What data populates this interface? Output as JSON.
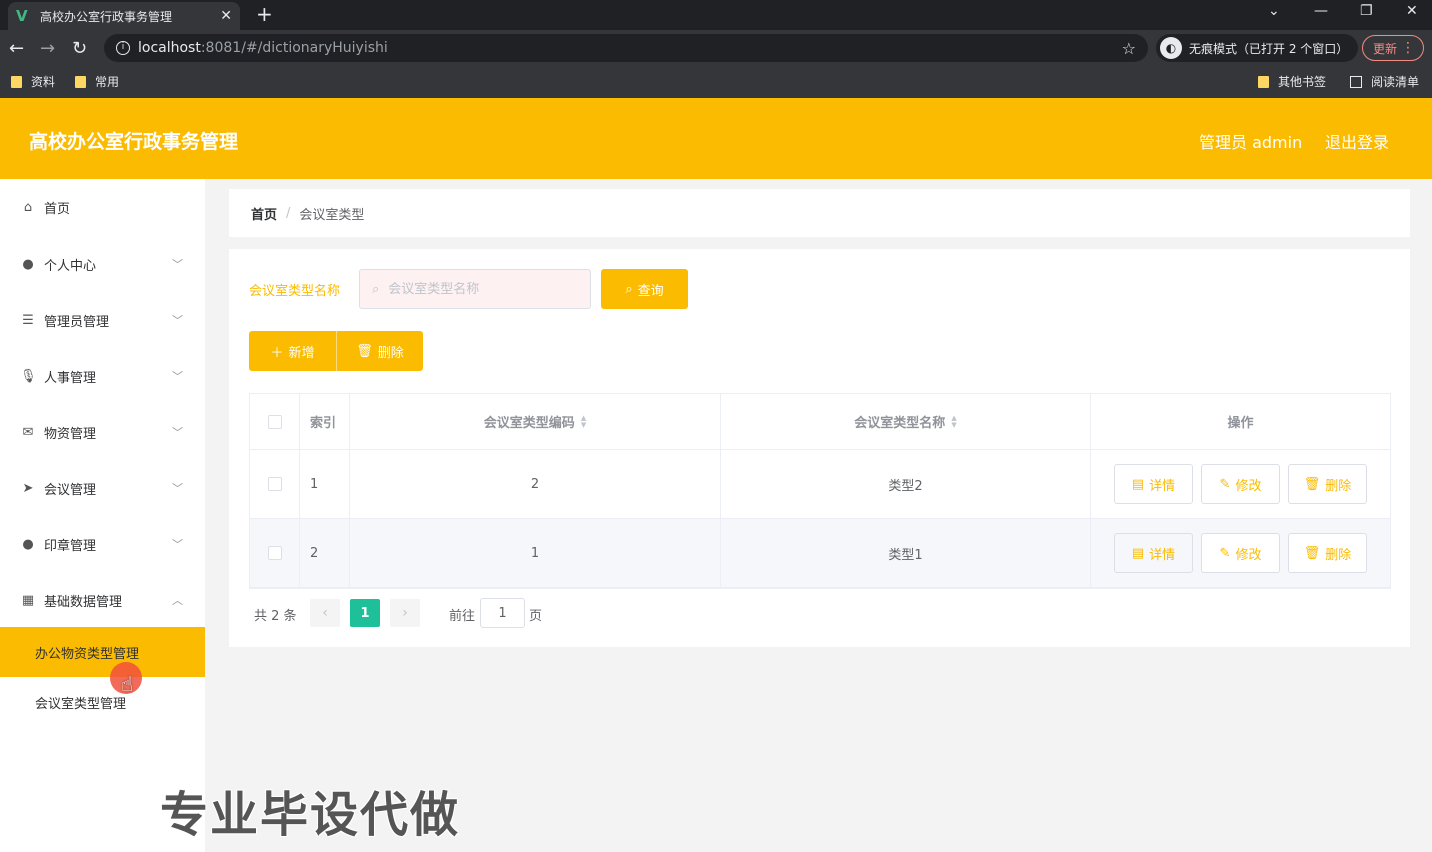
{
  "browser": {
    "tab_title": "高校办公室行政事务管理",
    "url_host": "localhost",
    "url_rest": ":8081/#/dictionaryHuiyishi",
    "incognito_label": "无痕模式（已打开 2 个窗口）",
    "update_label": "更新",
    "bookmarks": [
      "资料",
      "常用",
      "其他书签",
      "阅读清单"
    ]
  },
  "header": {
    "title": "高校办公室行政事务管理",
    "admin_label": "管理员 admin",
    "logout_label": "退出登录"
  },
  "sidebar": {
    "items": [
      {
        "label": "首页",
        "icon": "home-icon"
      },
      {
        "label": "个人中心",
        "icon": "user-icon"
      },
      {
        "label": "管理员管理",
        "icon": "sliders-icon"
      },
      {
        "label": "人事管理",
        "icon": "microphone-icon"
      },
      {
        "label": "物资管理",
        "icon": "mail-icon"
      },
      {
        "label": "会议管理",
        "icon": "send-icon"
      },
      {
        "label": "印章管理",
        "icon": "user-icon"
      },
      {
        "label": "基础数据管理",
        "icon": "grid-icon"
      }
    ],
    "subitems": [
      "办公物资类型管理",
      "会议室类型管理"
    ]
  },
  "breadcrumb": {
    "home": "首页",
    "separator": "/",
    "current": "会议室类型"
  },
  "search": {
    "label": "会议室类型名称",
    "placeholder": "会议室类型名称",
    "query_label": "查询"
  },
  "toolbar": {
    "add_label": "新增",
    "delete_label": "删除"
  },
  "table": {
    "headers": {
      "index": "索引",
      "code": "会议室类型编码",
      "name": "会议室类型名称",
      "ops": "操作"
    },
    "rows": [
      {
        "index": "1",
        "code": "2",
        "name": "类型2"
      },
      {
        "index": "2",
        "code": "1",
        "name": "类型1"
      }
    ],
    "actions": {
      "detail": "详情",
      "edit": "修改",
      "delete": "删除"
    }
  },
  "pagination": {
    "total": "共 2 条",
    "current_page": "1",
    "goto_label": "前往",
    "goto_value": "1",
    "page_unit": "页"
  },
  "watermark": "专业毕设代做",
  "colors": {
    "accent": "#fbbb00",
    "pager_active": "#1ec09a"
  }
}
